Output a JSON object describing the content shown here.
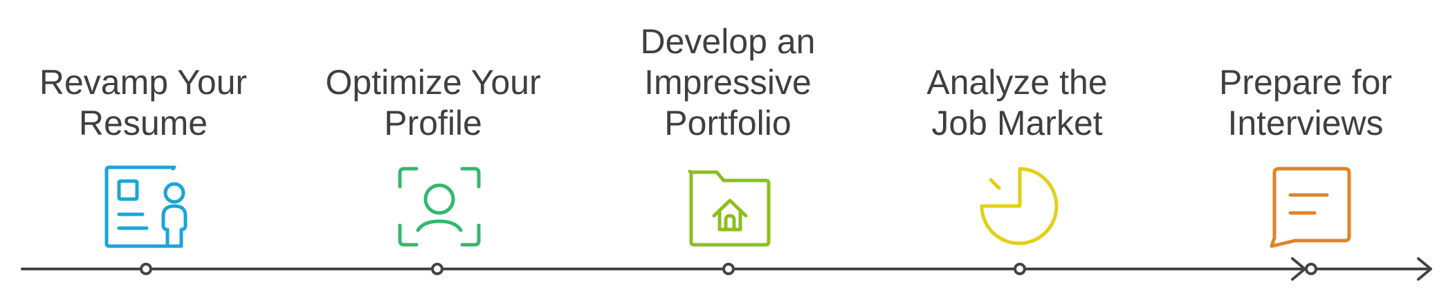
{
  "steps": [
    {
      "lines": [
        "Revamp Your",
        "Resume"
      ],
      "icon": "resume-icon",
      "color": "#1aa4d9"
    },
    {
      "lines": [
        "Optimize Your",
        "Profile"
      ],
      "icon": "profile-scan-icon",
      "color": "#33b86f"
    },
    {
      "lines": [
        "Develop an",
        "Impressive",
        "Portfolio"
      ],
      "icon": "portfolio-folder-icon",
      "color": "#8bbf1f"
    },
    {
      "lines": [
        "Analyze the",
        "Job Market"
      ],
      "icon": "pie-chart-icon",
      "color": "#e3cf16"
    },
    {
      "lines": [
        "Prepare for",
        "Interviews"
      ],
      "icon": "chat-bubble-icon",
      "color": "#e0832a"
    }
  ],
  "timeline": {
    "color": "#444444"
  }
}
